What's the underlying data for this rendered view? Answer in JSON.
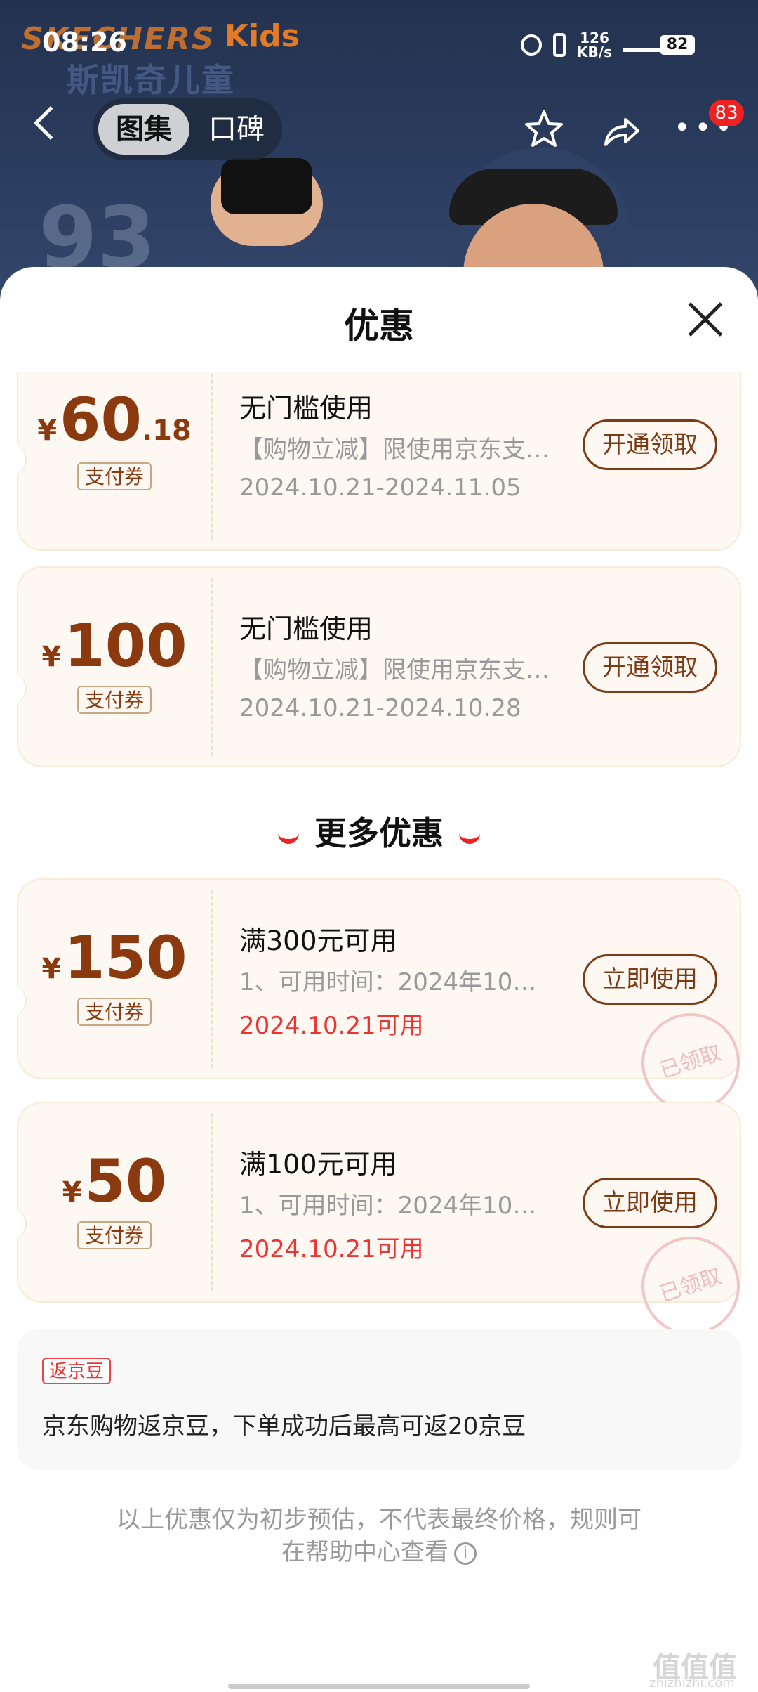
{
  "status": {
    "time": "08:26",
    "net_top": "126",
    "net_bottom": "KB/s",
    "battery": "82"
  },
  "hero": {
    "brand": "SKECHERS",
    "kids": "Kids",
    "brand_cn": "斯凯奇儿童",
    "price_partial": "93"
  },
  "nav": {
    "tabs": [
      "图集",
      "口碑"
    ],
    "badge": "83"
  },
  "sheet": {
    "title": "优惠"
  },
  "coupons": [
    {
      "yen": "¥",
      "amount": "60",
      "decimal": ".18",
      "tag": "支付券",
      "title": "无门槛使用",
      "desc": "【购物立减】限使用京东支…",
      "date": "2024.10.21-2024.11.05",
      "button": "开通领取"
    },
    {
      "yen": "¥",
      "amount": "100",
      "decimal": "",
      "tag": "支付券",
      "title": "无门槛使用",
      "desc": "【购物立减】限使用京东支…",
      "date": "2024.10.21-2024.10.28",
      "button": "开通领取"
    }
  ],
  "more_section": {
    "title": "更多优惠"
  },
  "more_coupons": [
    {
      "yen": "¥",
      "amount": "150",
      "tag": "支付券",
      "title": "满300元可用",
      "desc": "1、可用时间：2024年10…",
      "date": "2024.10.21可用",
      "button": "立即使用",
      "stamp": "已领取"
    },
    {
      "yen": "¥",
      "amount": "50",
      "tag": "支付券",
      "title": "满100元可用",
      "desc": "1、可用时间：2024年10…",
      "date": "2024.10.21可用",
      "button": "立即使用",
      "stamp": "已领取"
    }
  ],
  "bean": {
    "tag": "返京豆",
    "text": "京东购物返京豆，下单成功后最高可返20京豆"
  },
  "footer": {
    "line1": "以上优惠仅为初步预估，不代表最终价格，规则可",
    "line2": "在帮助中心查看"
  },
  "watermark": {
    "main": "值值值",
    "sub": "zhizhizhi.com"
  }
}
